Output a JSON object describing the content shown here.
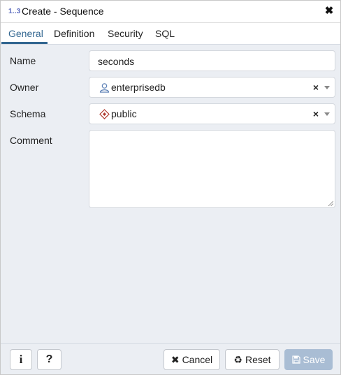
{
  "title_bar": {
    "icon_text": "1..3",
    "title": "Create - Sequence",
    "close_symbol": "✖"
  },
  "tabs": [
    {
      "label": "General",
      "active": true
    },
    {
      "label": "Definition",
      "active": false
    },
    {
      "label": "Security",
      "active": false
    },
    {
      "label": "SQL",
      "active": false
    }
  ],
  "form": {
    "name": {
      "label": "Name",
      "value": "seconds"
    },
    "owner": {
      "label": "Owner",
      "value": "enterprisedb",
      "icon": "user-icon",
      "clear_symbol": "×"
    },
    "schema": {
      "label": "Schema",
      "value": "public",
      "icon": "schema-icon",
      "clear_symbol": "×"
    },
    "comment": {
      "label": "Comment",
      "value": ""
    }
  },
  "footer": {
    "info_symbol": "i",
    "help_symbol": "?",
    "cancel_label": "Cancel",
    "cancel_symbol": "✖",
    "reset_label": "Reset",
    "reset_symbol": "♻",
    "save_label": "Save",
    "save_enabled": false
  },
  "colors": {
    "accent": "#326690",
    "save_disabled_bg": "#a9bdd4",
    "schema_icon": "#b03a2e",
    "user_icon": "#5a7fb5"
  }
}
